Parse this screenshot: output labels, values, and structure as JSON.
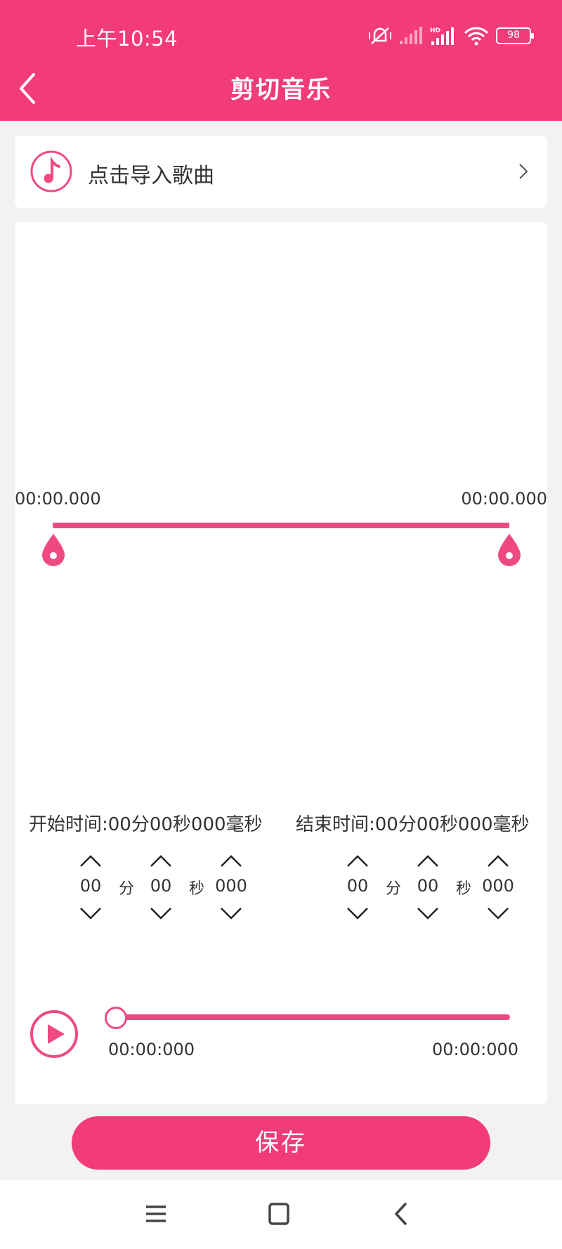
{
  "status_bar": {
    "time": "上午10:54",
    "battery": "98"
  },
  "header": {
    "title": "剪切音乐"
  },
  "import": {
    "label": "点击导入歌曲"
  },
  "range": {
    "start_label": "00:00.000",
    "end_label": "00:00.000"
  },
  "start_time": {
    "summary": "开始时间:00分00秒000毫秒",
    "minutes": "00",
    "minutes_unit": "分",
    "seconds": "00",
    "seconds_unit": "秒",
    "millis": "000"
  },
  "end_time": {
    "summary": "结束时间:00分00秒000毫秒",
    "minutes": "00",
    "minutes_unit": "分",
    "seconds": "00",
    "seconds_unit": "秒",
    "millis": "000"
  },
  "player": {
    "current": "00:00:000",
    "total": "00:00:000",
    "progress": 0
  },
  "save_label": "保存",
  "colors": {
    "accent": "#f23c77",
    "background": "#f2f2f2"
  }
}
